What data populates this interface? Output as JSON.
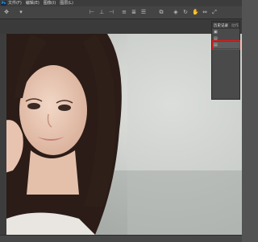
{
  "menubar": {
    "app_icon_label": "Ps",
    "items": [
      "文件(F)",
      "编辑(E)",
      "图像(I)",
      "图层(L)"
    ]
  },
  "icons": {
    "history_state_icon": "photo-icon",
    "history_snapshot_icon": "snapshot-icon"
  },
  "history_panel": {
    "tab_active": "历史记录",
    "tab_inactive": "动作",
    "highlight_color": "#e11b1b"
  }
}
